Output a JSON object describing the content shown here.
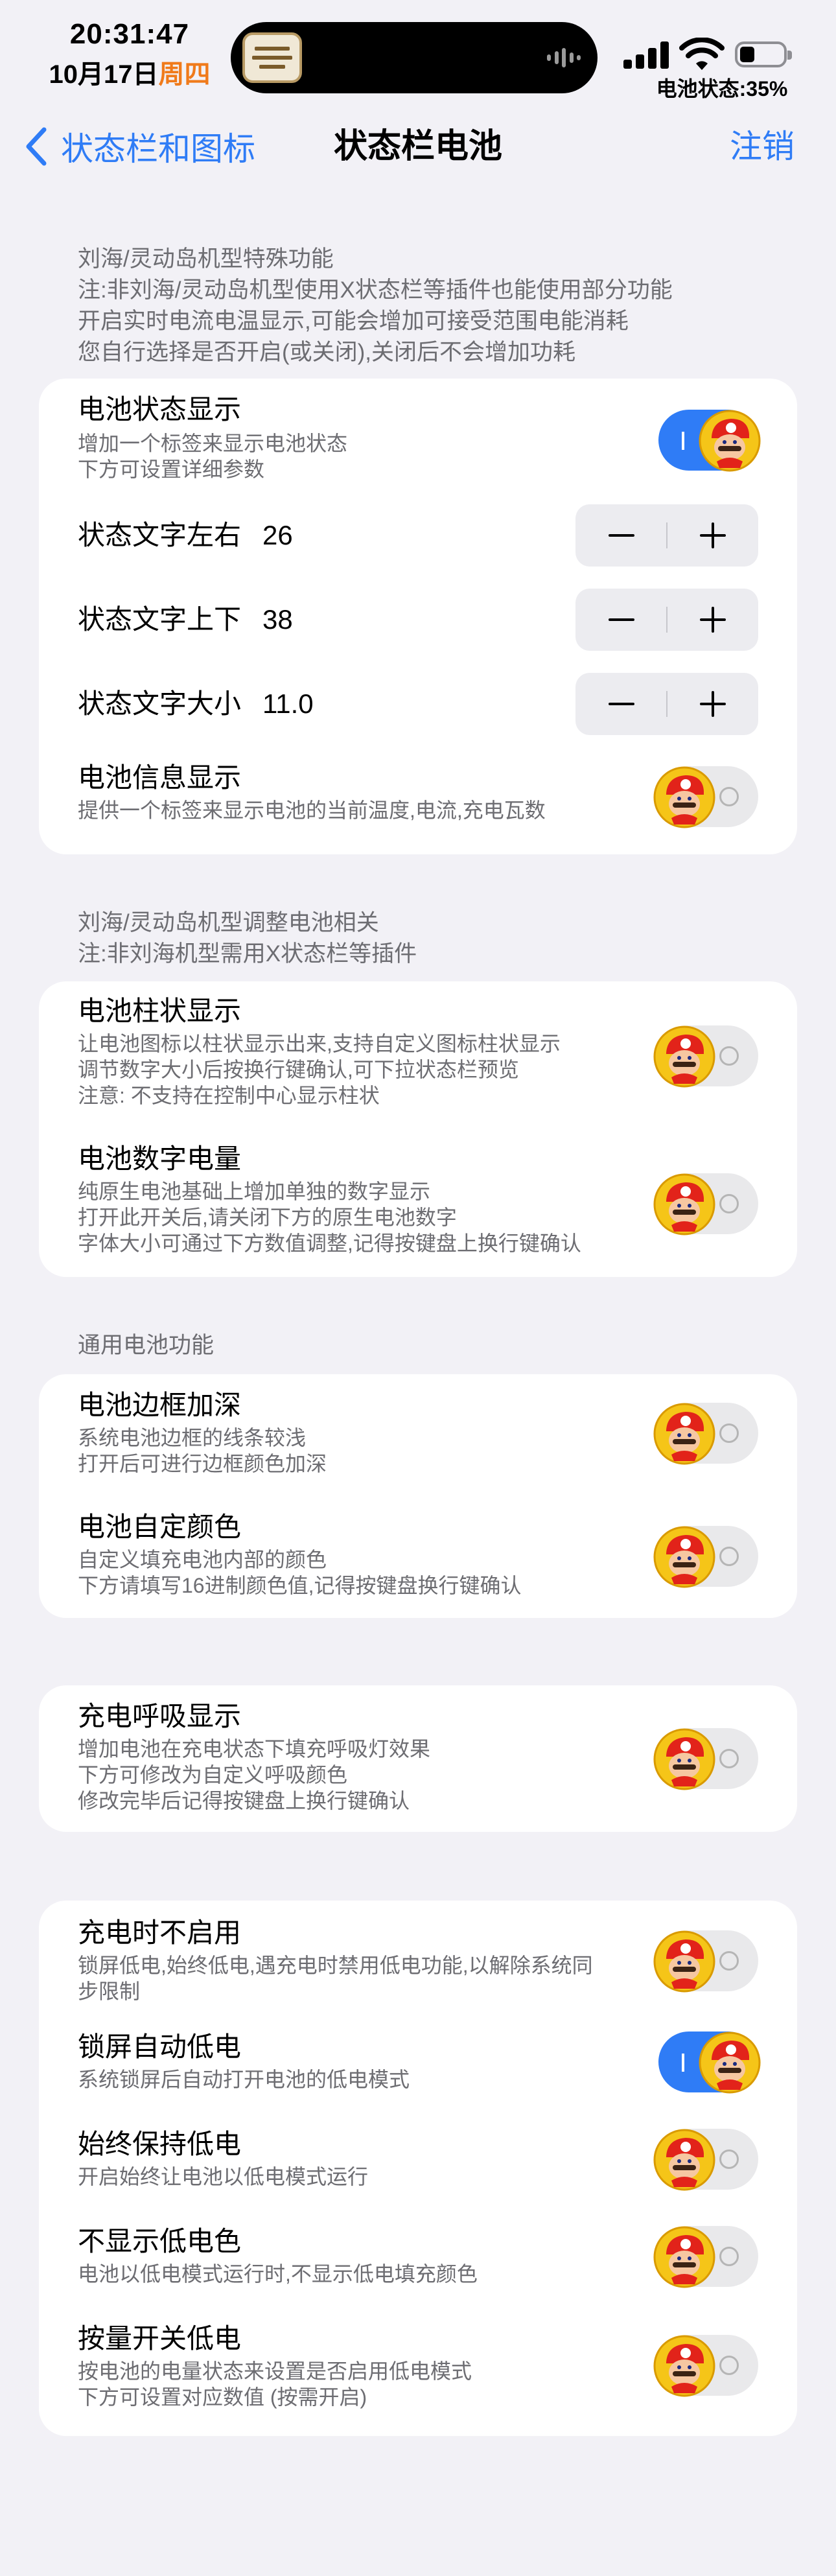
{
  "status_bar": {
    "time": "20:31:47",
    "date": "10月17日",
    "weekday": "周四",
    "battery_text": "电池状态:35%",
    "battery_level_percent": 35
  },
  "nav": {
    "back_label": "状态栏和图标",
    "title": "状态栏电池",
    "action_label": "注销"
  },
  "colors": {
    "accent": "#2f7cf6",
    "weekday": "#f07a1a",
    "background": "#f2f1f6",
    "toggle_off": "#e9e9eb"
  },
  "section1": {
    "header_lines": [
      "刘海/灵动岛机型特殊功能",
      "注:非刘海/灵动岛机型使用X状态栏等插件也能使用部分功能",
      "开启实时电流电温显示,可能会增加可接受范围电能消耗",
      "您自行选择是否开启(或关闭),关闭后不会增加功耗"
    ],
    "battery_status": {
      "title": "电池状态显示",
      "sub": [
        "增加一个标签来显示电池状态",
        "下方可设置详细参数"
      ],
      "on": true
    },
    "text_left": {
      "title": "状态文字左右",
      "value": "26"
    },
    "text_top": {
      "title": "状态文字上下",
      "value": "38"
    },
    "text_size": {
      "title": "状态文字大小",
      "value": "11.0"
    },
    "battery_info": {
      "title": "电池信息显示",
      "sub": [
        "提供一个标签来显示电池的当前温度,电流,充电瓦数"
      ],
      "on": false
    }
  },
  "section2": {
    "header_lines": [
      "刘海/灵动岛机型调整电池相关",
      "注:非刘海机型需用X状态栏等插件"
    ],
    "bar_display": {
      "title": "电池柱状显示",
      "sub": [
        "让电池图标以柱状显示出来,支持自定义图标柱状显示",
        "调节数字大小后按换行键确认,可下拉状态栏预览",
        "注意: 不支持在控制中心显示柱状"
      ],
      "on": false
    },
    "digit_level": {
      "title": "电池数字电量",
      "sub": [
        "纯原生电池基础上增加单独的数字显示",
        "打开此开关后,请关闭下方的原生电池数字",
        "字体大小可通过下方数值调整,记得按键盘上换行键确认"
      ],
      "on": false
    }
  },
  "section3": {
    "header_lines": [
      "通用电池功能"
    ],
    "border_deep": {
      "title": "电池边框加深",
      "sub": [
        "系统电池边框的线条较浅",
        "打开后可进行边框颜色加深"
      ],
      "on": false
    },
    "custom_color": {
      "title": "电池自定颜色",
      "sub": [
        "自定义填充电池内部的颜色",
        "下方请填写16进制颜色值,记得按键盘换行键确认"
      ],
      "on": false
    }
  },
  "section4": {
    "breath": {
      "title": "充电呼吸显示",
      "sub": [
        "增加电池在充电状态下填充呼吸灯效果",
        "下方可修改为自定义呼吸颜色",
        "修改完毕后记得按键盘上换行键确认"
      ],
      "on": false
    }
  },
  "section5": {
    "charge_no_low": {
      "title": "充电时不启用",
      "sub": [
        "锁屏低电,始终低电,遇充电时禁用低电功能,以解除系统同",
        "步限制"
      ],
      "on": false
    },
    "lock_low": {
      "title": "锁屏自动低电",
      "sub": [
        "系统锁屏后自动打开电池的低电模式"
      ],
      "on": true
    },
    "always_low": {
      "title": "始终保持低电",
      "sub": [
        "开启始终让电池以低电模式运行"
      ],
      "on": false
    },
    "no_low_color": {
      "title": "不显示低电色",
      "sub": [
        "电池以低电模式运行时,不显示低电填充颜色"
      ],
      "on": false
    },
    "level_low": {
      "title": "按量开关低电",
      "sub": [
        "按电池的电量状态来设置是否启用低电模式",
        "下方可设置对应数值 (按需开启)"
      ],
      "on": false
    }
  }
}
